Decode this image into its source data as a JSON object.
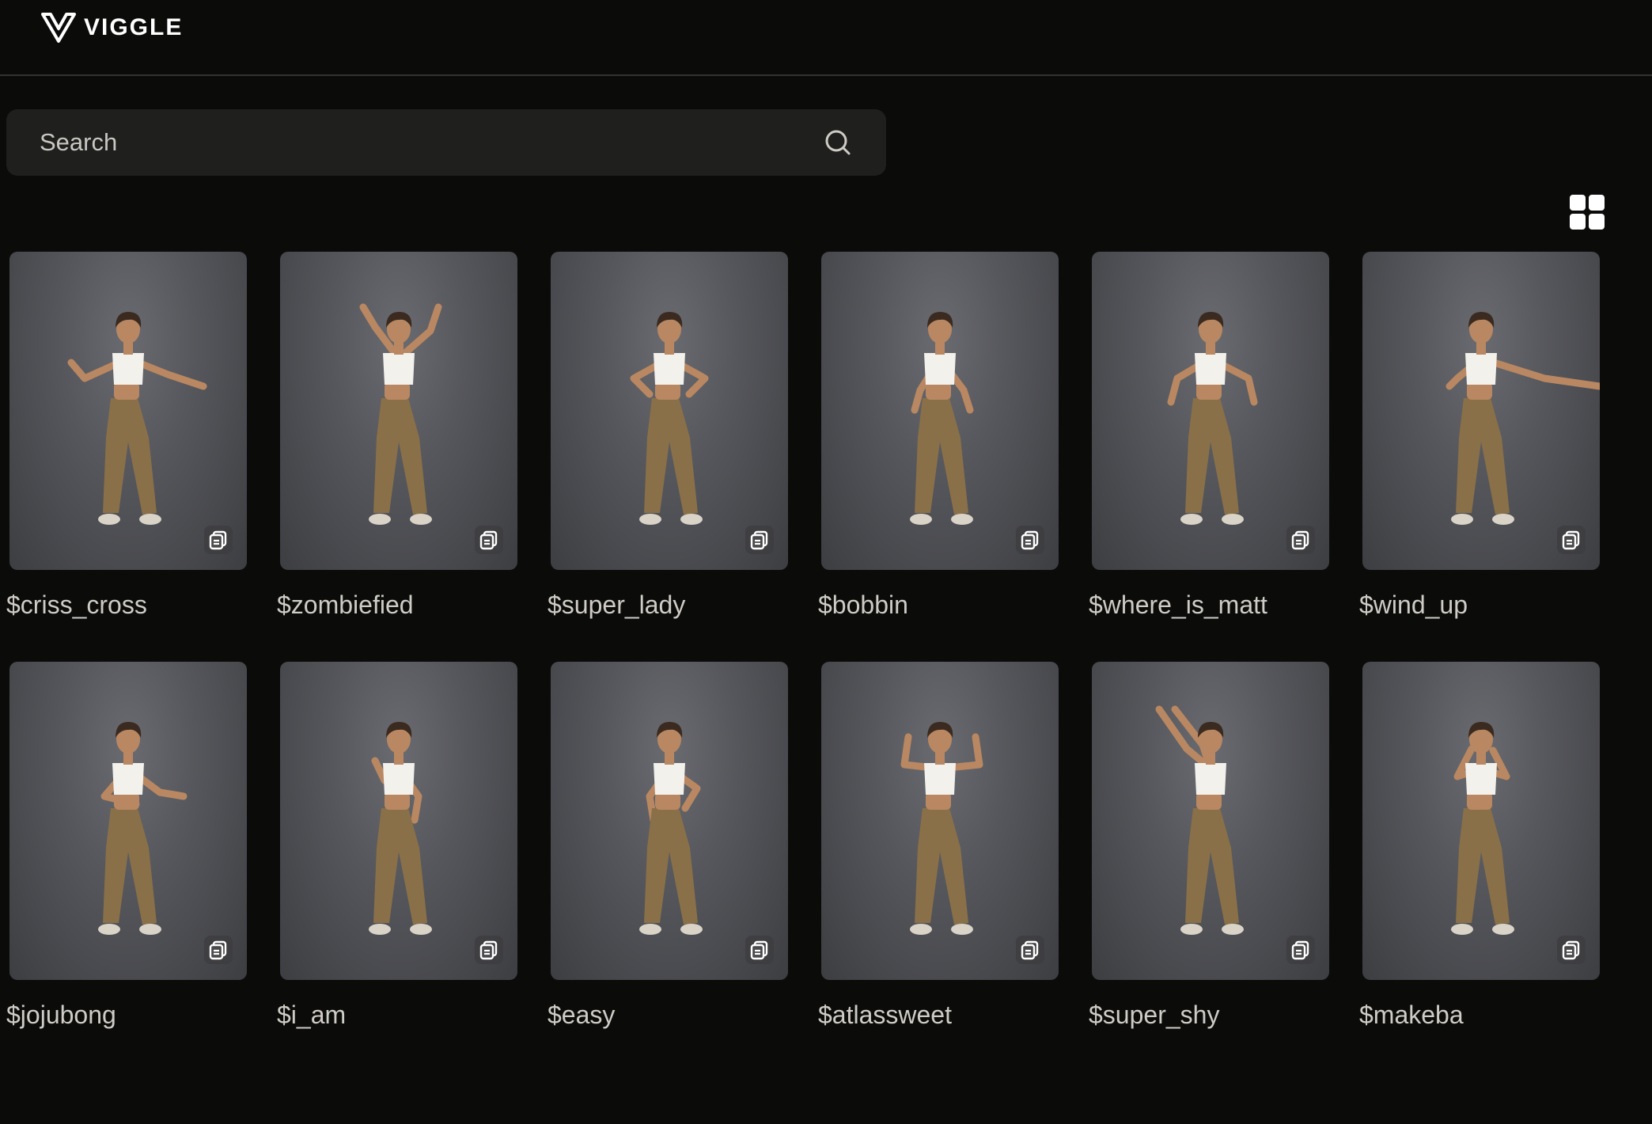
{
  "header": {
    "brand": "VIGGLE",
    "logo_icon": "viggle-v-logo-icon"
  },
  "search": {
    "placeholder": "Search",
    "icon": "search-icon"
  },
  "view_toggle": {
    "icon": "grid-view-icon"
  },
  "templates": [
    {
      "label": "$criss_cross",
      "pose": "lean-arm-out"
    },
    {
      "label": "$zombiefied",
      "pose": "arms-up"
    },
    {
      "label": "$super_lady",
      "pose": "hands-on-hips"
    },
    {
      "label": "$bobbin",
      "pose": "arms-down"
    },
    {
      "label": "$where_is_matt",
      "pose": "elbows-out"
    },
    {
      "label": "$wind_up",
      "pose": "arm-extended"
    },
    {
      "label": "$jojubong",
      "pose": "arms-crossed"
    },
    {
      "label": "$i_am",
      "pose": "side-standing"
    },
    {
      "label": "$easy",
      "pose": "hand-on-hip"
    },
    {
      "label": "$atlassweet",
      "pose": "flex"
    },
    {
      "label": "$super_shy",
      "pose": "arms-raised-side"
    },
    {
      "label": "$makeba",
      "pose": "hands-to-face"
    }
  ],
  "card_icon": "copy-icon",
  "colors": {
    "background": "#0b0b0a",
    "search_bg": "#1f1f1d",
    "pants": "#8a7048",
    "top": "#f3f1ec",
    "skin": "#b98862"
  }
}
